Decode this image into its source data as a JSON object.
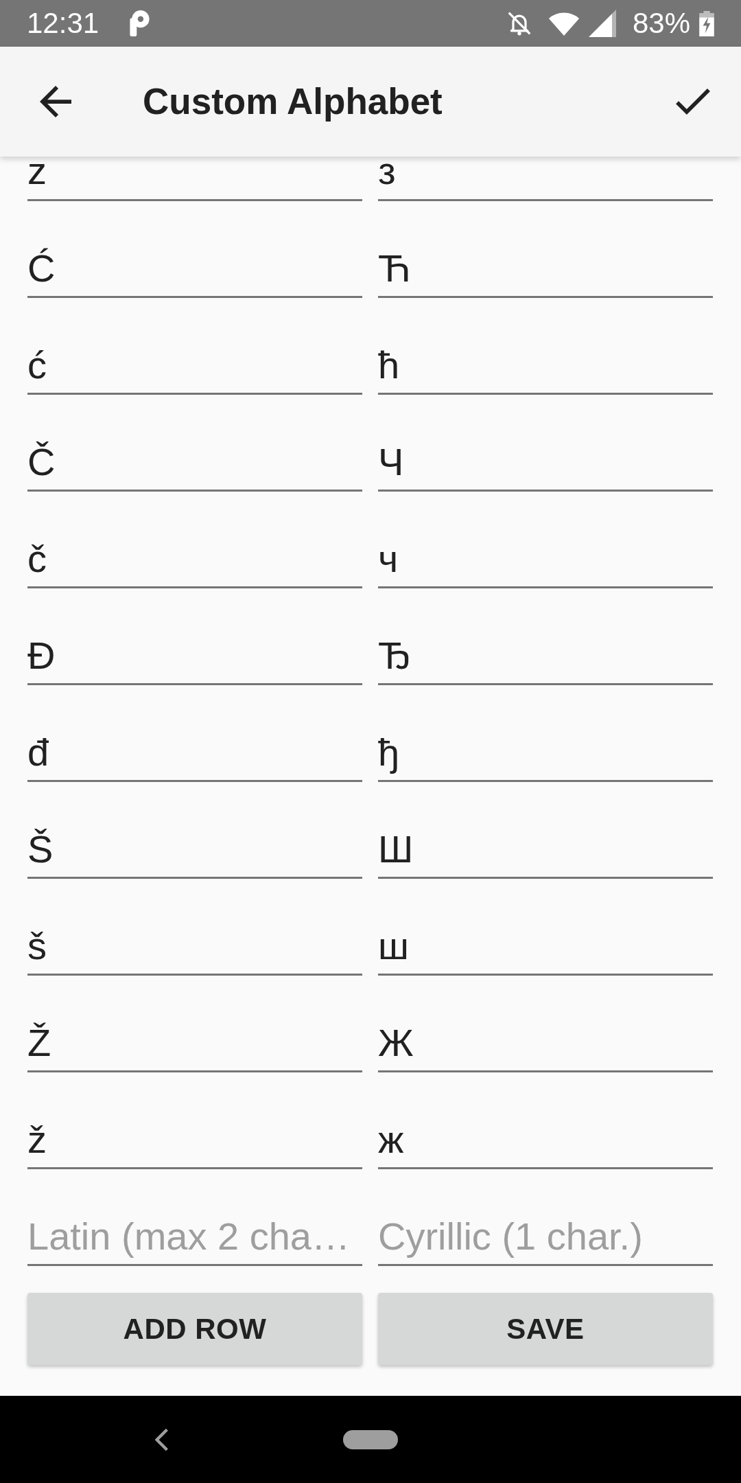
{
  "status_bar": {
    "time": "12:31",
    "battery": "83%"
  },
  "app_bar": {
    "title": "Custom Alphabet"
  },
  "rows": [
    {
      "latin": "z",
      "cyrillic": "з"
    },
    {
      "latin": "Ć",
      "cyrillic": "Ћ"
    },
    {
      "latin": "ć",
      "cyrillic": "ћ"
    },
    {
      "latin": "Č",
      "cyrillic": "Ч"
    },
    {
      "latin": "č",
      "cyrillic": "ч"
    },
    {
      "latin": "Đ",
      "cyrillic": "Ђ"
    },
    {
      "latin": "đ",
      "cyrillic": "ђ"
    },
    {
      "latin": "Š",
      "cyrillic": "Ш"
    },
    {
      "latin": "š",
      "cyrillic": "ш"
    },
    {
      "latin": "Ž",
      "cyrillic": "Ж"
    },
    {
      "latin": "ž",
      "cyrillic": "ж"
    }
  ],
  "new_row": {
    "latin_placeholder": "Latin (max 2 cha…",
    "cyrillic_placeholder": "Cyrillic (1 char.)"
  },
  "buttons": [
    {
      "label": "ADD ROW"
    },
    {
      "label": "SAVE"
    }
  ]
}
